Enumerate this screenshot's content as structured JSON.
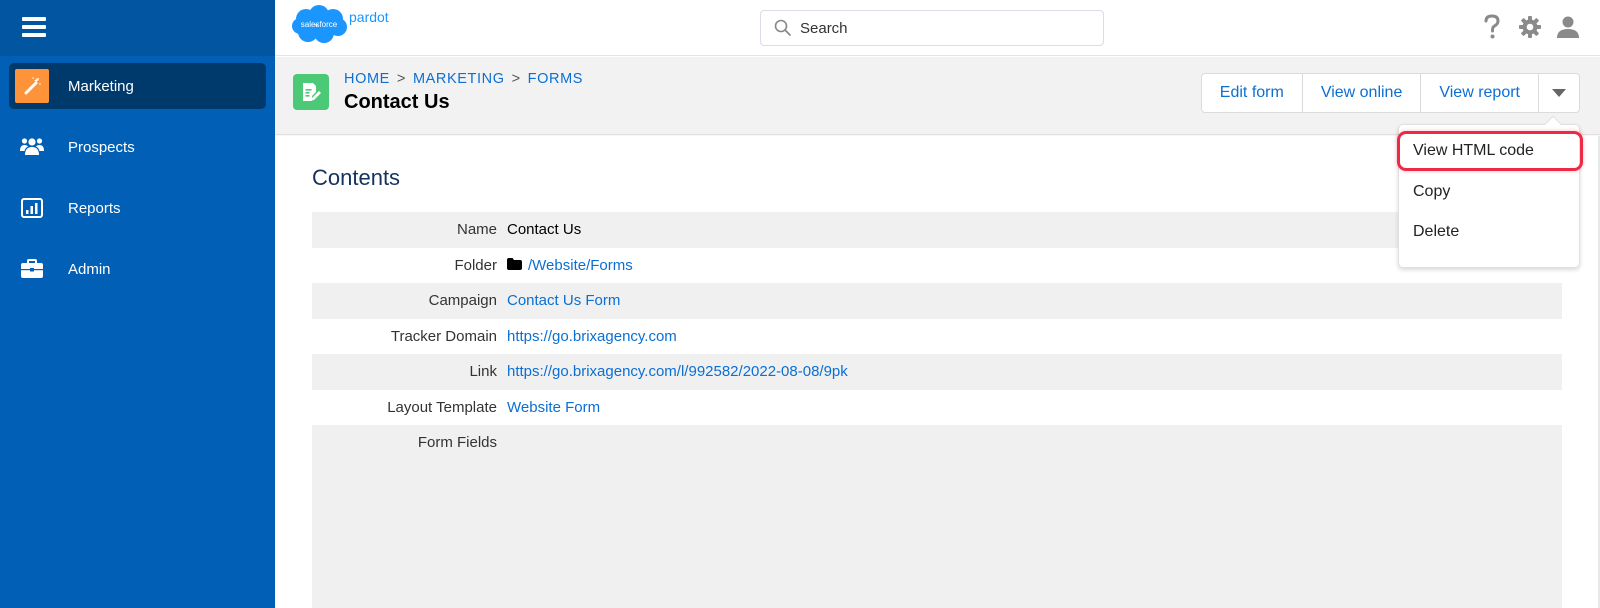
{
  "app": {
    "brand_cloud_text": "salesforce",
    "brand_product": "pardot"
  },
  "colors": {
    "sidebar_bg": "#0160b6",
    "sidebar_active_bg": "#00396b",
    "marketing_icon_bg": "#fe9339",
    "form_icon_bg": "#4bc976",
    "link": "#0b6fd3",
    "highlight_border": "#ec2a45"
  },
  "sidebar": {
    "menu_icon": "hamburger-icon",
    "items": [
      {
        "label": "Marketing",
        "icon": "magic-wand-icon",
        "active": true
      },
      {
        "label": "Prospects",
        "icon": "people-icon",
        "active": false
      },
      {
        "label": "Reports",
        "icon": "bar-chart-icon",
        "active": false
      },
      {
        "label": "Admin",
        "icon": "briefcase-icon",
        "active": false
      }
    ]
  },
  "header": {
    "search": {
      "placeholder": "Search",
      "value": ""
    },
    "icons": [
      "help-icon",
      "gear-icon",
      "user-icon"
    ]
  },
  "page": {
    "breadcrumb": [
      {
        "label": "HOME"
      },
      {
        "label": "MARKETING"
      },
      {
        "label": "FORMS"
      }
    ],
    "breadcrumb_separator": ">",
    "title": "Contact Us",
    "icon": "form-icon",
    "actions": {
      "edit": "Edit form",
      "view_online": "View online",
      "view_report": "View report",
      "more_icon": "caret-down-icon"
    }
  },
  "dropdown": {
    "items": [
      {
        "label": "View HTML code",
        "highlighted": true
      },
      {
        "label": "Copy",
        "highlighted": false
      },
      {
        "label": "Delete",
        "highlighted": false
      }
    ]
  },
  "content": {
    "section_title": "Contents",
    "fields": [
      {
        "label": "Name",
        "value": "Contact Us",
        "link": false
      },
      {
        "label": "Folder",
        "value": "/Website/Forms",
        "link": true,
        "icon": "folder-icon"
      },
      {
        "label": "Campaign",
        "value": "Contact Us Form",
        "link": true
      },
      {
        "label": "Tracker Domain",
        "value": "https://go.brixagency.com",
        "link": true
      },
      {
        "label": "Link",
        "value": "https://go.brixagency.com/l/992582/2022-08-08/9pk",
        "link": true
      },
      {
        "label": "Layout Template",
        "value": "Website Form",
        "link": true
      },
      {
        "label": "Form Fields",
        "value": "",
        "link": false
      }
    ]
  }
}
